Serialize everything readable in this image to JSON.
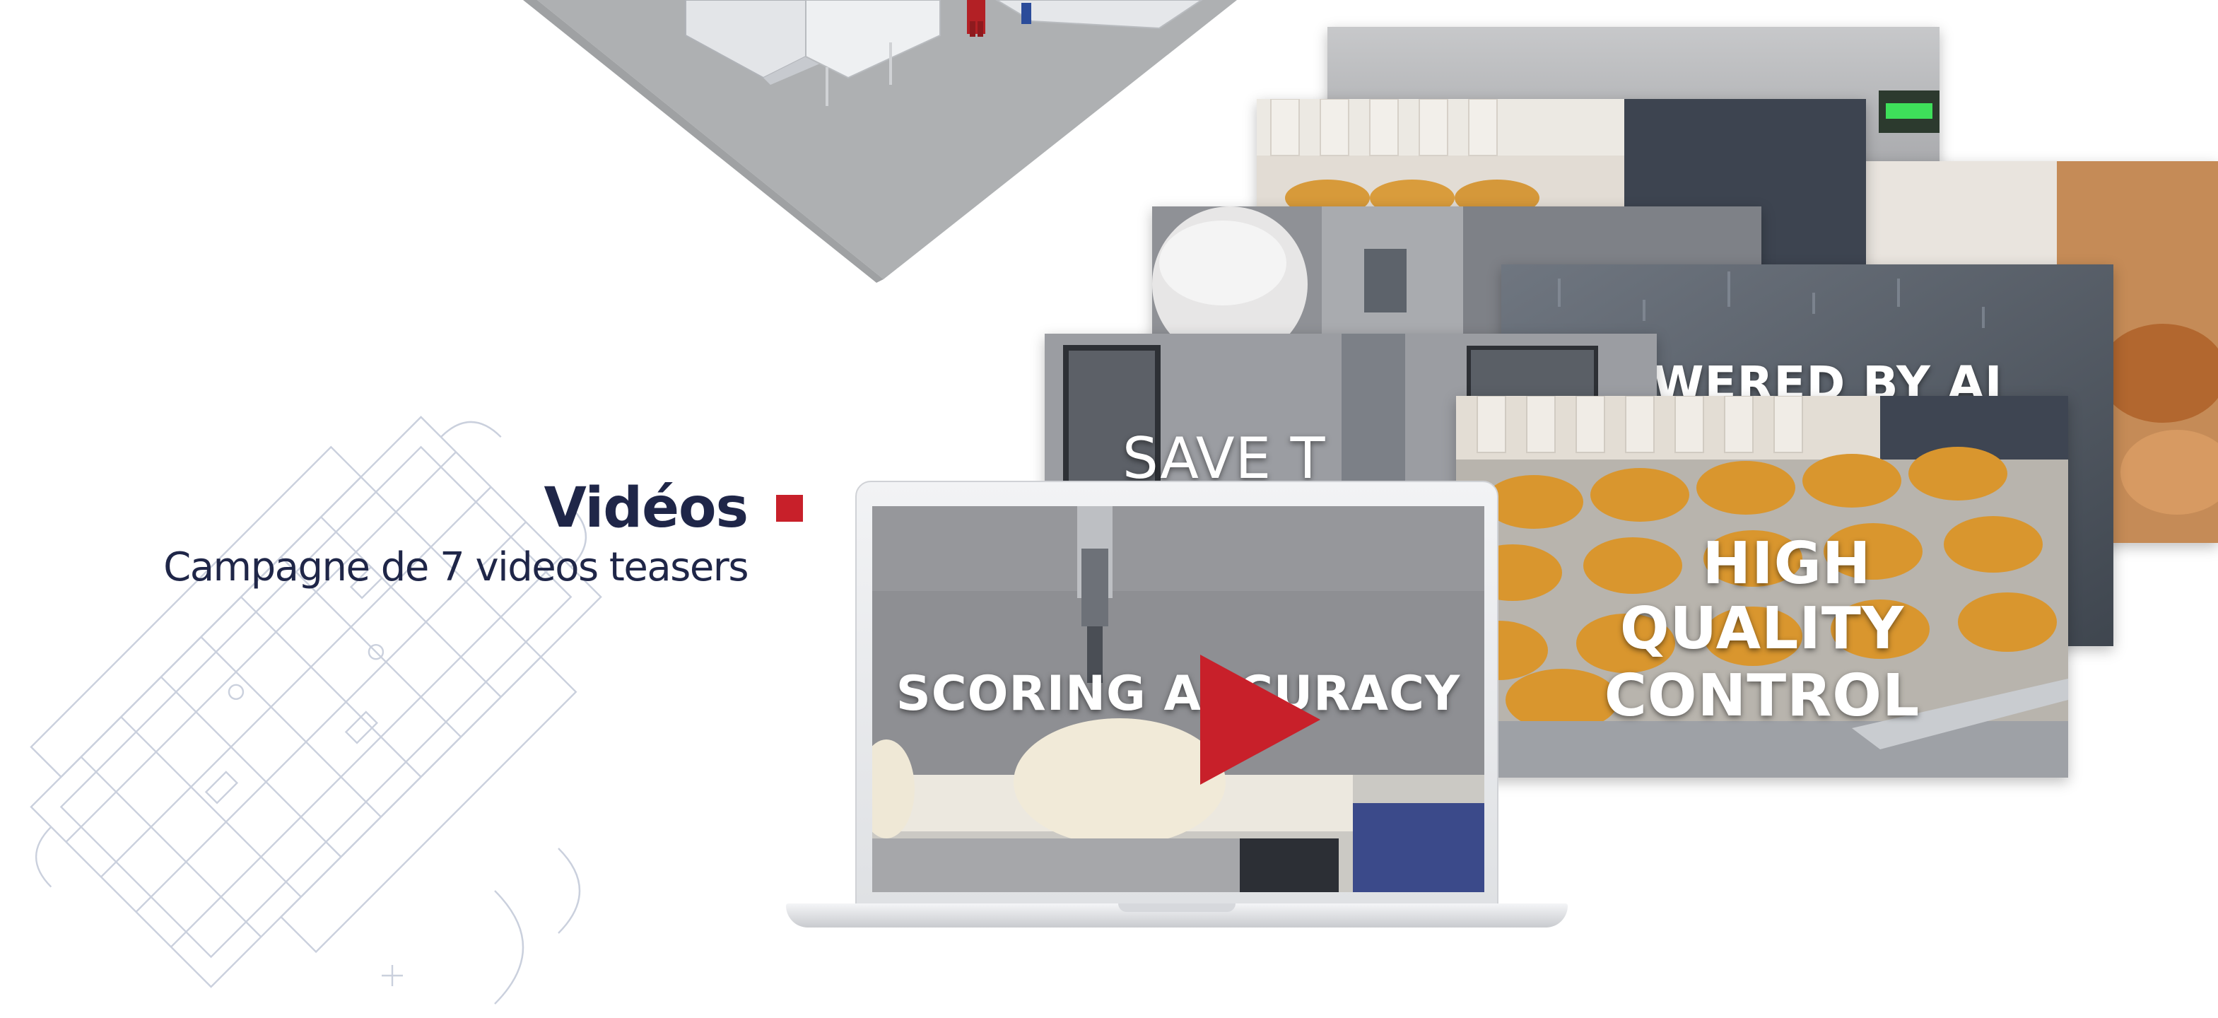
{
  "section": {
    "title": "Vidéos",
    "subtitle": "Campagne de 7 videos teasers"
  },
  "videos": [
    {
      "caption": "SCORING ACCURACY"
    },
    {
      "caption": "HIGH"
    },
    {
      "caption": "QUALITY CONTROL"
    },
    {
      "caption": "OWERED BY AI"
    },
    {
      "caption": "SAVE T"
    }
  ],
  "colors": {
    "accent": "#c8202a",
    "title": "#1f2648"
  },
  "icons": {
    "play": "play-icon"
  }
}
